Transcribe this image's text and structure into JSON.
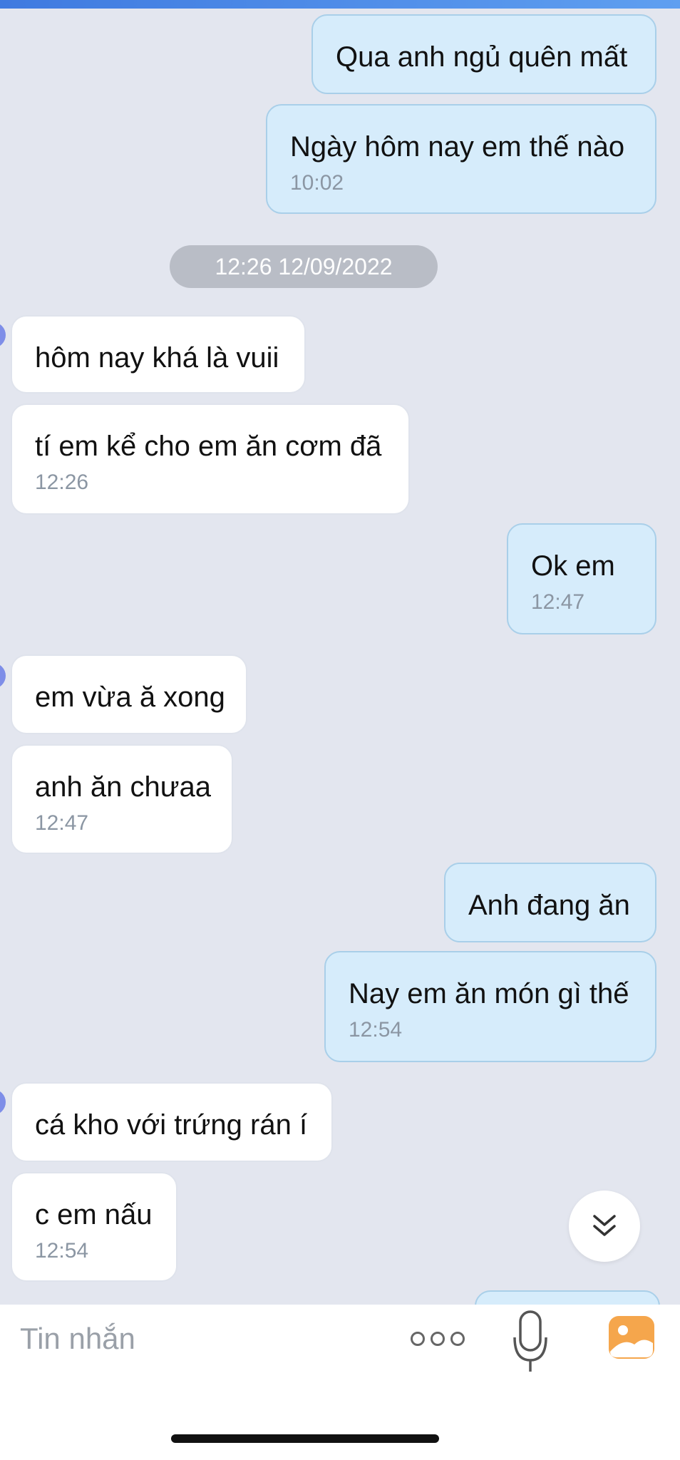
{
  "messages": [
    {
      "side": "out",
      "text": "Qua anh ngủ quên mất",
      "time": ""
    },
    {
      "side": "out",
      "text": "Ngày hôm nay em thế nào",
      "time": "10:02"
    },
    {
      "side": "in",
      "text": "hôm nay khá là vuii",
      "time": ""
    },
    {
      "side": "in",
      "text": "tí em kể cho em ăn cơm đã",
      "time": "12:26"
    },
    {
      "side": "out",
      "text": "Ok em",
      "time": "12:47"
    },
    {
      "side": "in",
      "text": "em vừa ă xong",
      "time": ""
    },
    {
      "side": "in",
      "text": "anh ăn chưaa",
      "time": "12:47"
    },
    {
      "side": "out",
      "text": "Anh đang ăn",
      "time": ""
    },
    {
      "side": "out",
      "text": "Nay em ăn món gì thế",
      "time": "12:54"
    },
    {
      "side": "in",
      "text": "cá kho với trứng rán í",
      "time": ""
    },
    {
      "side": "in",
      "text": "c em nấu",
      "time": "12:54"
    }
  ],
  "date_separator": "12:26 12/09/2022",
  "composer": {
    "placeholder": "Tin nhắn",
    "more_icon": "more-dots-icon",
    "mic_icon": "microphone-icon",
    "image_icon": "image-gallery-icon"
  },
  "scroll_down_icon": "double-chevron-down-icon",
  "colors": {
    "background": "#e3e6ef",
    "incoming_bubble": "#ffffff",
    "outgoing_bubble": "#d6ecfb",
    "outgoing_border": "#a9cfe9",
    "timestamp": "#8b96a3",
    "accent_orange": "#f5a64c"
  }
}
